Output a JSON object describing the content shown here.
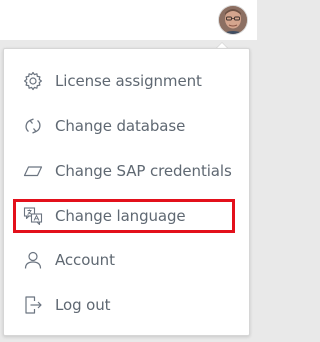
{
  "header": {
    "avatar_label": "User avatar"
  },
  "menu": {
    "items": [
      {
        "label": "License assignment",
        "icon": "gear-icon"
      },
      {
        "label": "Change database",
        "icon": "sync-icon"
      },
      {
        "label": "Change SAP credentials",
        "icon": "parallelogram-icon"
      },
      {
        "label": "Change language",
        "icon": "translate-icon",
        "highlighted": true
      },
      {
        "label": "Account",
        "icon": "user-icon"
      },
      {
        "label": "Log out",
        "icon": "logout-icon"
      }
    ]
  },
  "colors": {
    "text": "#5f6872",
    "icon": "#6b7480",
    "highlight": "#e3101b",
    "menu_bg": "#ffffff",
    "page_bg": "#e9e9e9"
  }
}
